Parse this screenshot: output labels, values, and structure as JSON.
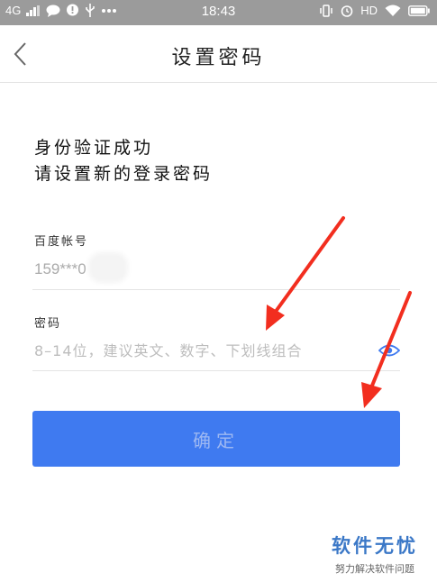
{
  "status_bar": {
    "network": "4G",
    "time": "18:43",
    "hd": "HD"
  },
  "header": {
    "title": "设置密码"
  },
  "message": {
    "line1": "身份验证成功",
    "line2": "请设置新的登录密码"
  },
  "account": {
    "label": "百度帐号",
    "value": "159***0"
  },
  "password": {
    "label": "密码",
    "placeholder": "8–14位，建议英文、数字、下划线组合",
    "value": ""
  },
  "confirm_button": {
    "label": "确定"
  },
  "watermark": {
    "title": "软件无忧",
    "subtitle": "努力解决软件问题"
  },
  "colors": {
    "status_bar": "#9b9b9b",
    "button": "#3f7af0",
    "arrow": "#f22e1f",
    "watermark": "#3b78c7"
  }
}
